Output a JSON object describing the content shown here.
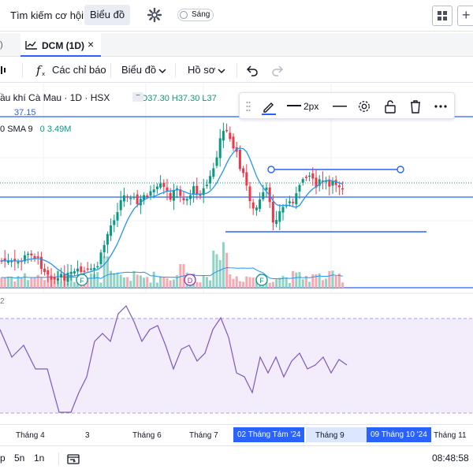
{
  "nav": {
    "search_label": "Tìm kiếm cơ hội",
    "chart_label": "Biểu đồ",
    "theme_label": "Sáng",
    "plus_label": "+"
  },
  "tabs": {
    "left_text": ")",
    "active_tab": "DCM (1D)",
    "close": "×"
  },
  "toolbar": {
    "indicators_label": "Các chỉ báo",
    "chart_label": "Biểu đồ",
    "profile_label": "Hồ sơ"
  },
  "legend": {
    "symbol_line": "ầu khí Cà Mau · 1D · HSX",
    "ohlc": "O37.30 H37.30 L37",
    "price_label": "37.15",
    "sma_label": "SMA 9",
    "vol_label": "0 3.49M"
  },
  "drawbar": {
    "width_label": "2px"
  },
  "markers": [
    "F",
    "D",
    "F"
  ],
  "time_axis": {
    "ticks": [
      "Tháng 4",
      "3",
      "Tháng 6",
      "Tháng 7",
      "Tháng 9",
      "Tháng 11"
    ],
    "highlight_start": "02 Tháng Tám '24",
    "highlight_end": "09 Tháng 10 '24"
  },
  "bottombar": {
    "items": [
      "p",
      "5n",
      "1n"
    ],
    "clock": "08:48:58"
  },
  "colors": {
    "up": "#089981",
    "down": "#f23645",
    "accent": "#2962ff",
    "sma": "#2196f3",
    "rsi_line": "#7e57c2",
    "rsi_fill": "#f0e8f8"
  }
}
